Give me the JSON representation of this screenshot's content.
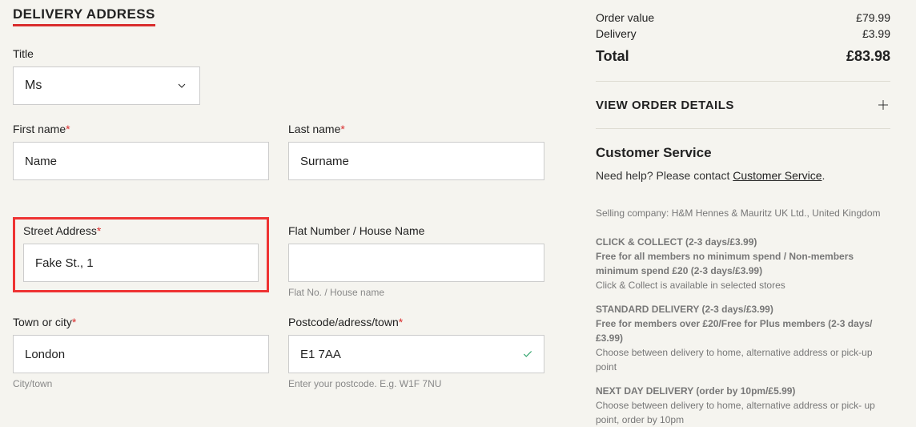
{
  "heading": "DELIVERY ADDRESS",
  "title_field": {
    "label": "Title",
    "value": "Ms"
  },
  "first_name": {
    "label": "First name",
    "value": "Name"
  },
  "last_name": {
    "label": "Last name",
    "value": "Surname"
  },
  "street": {
    "label": "Street Address",
    "value": "Fake St., 1"
  },
  "flat": {
    "label": "Flat Number / House Name",
    "value": "",
    "hint": "Flat No. / House name"
  },
  "town": {
    "label": "Town or city",
    "value": "London",
    "hint": "City/town"
  },
  "postcode": {
    "label": "Postcode/adress/town",
    "value": "E1 7AA",
    "hint": "Enter your postcode. E.g. W1F 7NU"
  },
  "summary": {
    "order_value_label": "Order value",
    "order_value": "£79.99",
    "delivery_label": "Delivery",
    "delivery": "£3.99",
    "total_label": "Total",
    "total": "£83.98",
    "view_order": "VIEW ORDER DETAILS"
  },
  "customer_service": {
    "heading": "Customer Service",
    "text_prefix": "Need help? Please contact ",
    "link": "Customer Service",
    "text_suffix": "."
  },
  "selling_company": "Selling company: H&M Hennes & Mauritz UK Ltd., United Kingdom",
  "shipping": {
    "cc_title": "CLICK & COLLECT (2-3 days/£3.99)",
    "cc_line1": "Free for all members no minimum spend / Non-members minimum spend £20 (2-3 days/£3.99)",
    "cc_line2": "Click & Collect is available in selected stores",
    "std_title": "STANDARD DELIVERY (2-3 days/£3.99)",
    "std_line1": "Free for members over £20/Free for Plus members (2-3 days/£3.99)",
    "std_line2": "Choose between delivery to home, alternative address or pick-up point",
    "nd_title": "NEXT DAY DELIVERY (order by 10pm/£5.99)",
    "nd_line1": "Choose between delivery to home, alternative address or pick- up point, order by 10pm"
  }
}
